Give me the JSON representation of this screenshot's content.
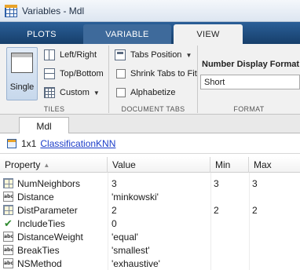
{
  "window": {
    "title": "Variables - Mdl"
  },
  "ribbon_tabs": [
    {
      "label": "PLOTS"
    },
    {
      "label": "VARIABLE"
    },
    {
      "label": "VIEW"
    }
  ],
  "tiles": {
    "single_label": "Single",
    "left_right": "Left/Right",
    "top_bottom": "Top/Bottom",
    "custom": "Custom",
    "section_label": "TILES"
  },
  "document_tabs": {
    "tabs_position": "Tabs Position",
    "shrink_tabs": "Shrink Tabs to Fit",
    "alphabetize": "Alphabetize",
    "section_label": "DOCUMENT TABS"
  },
  "format": {
    "label": "Number Display Format",
    "selected": "Short",
    "section_label": "FORMAT"
  },
  "doc_tab": {
    "label": "Mdl"
  },
  "info": {
    "size": "1x1",
    "class_name": "ClassificationKNN"
  },
  "table": {
    "headers": [
      "Property",
      "Value",
      "Min",
      "Max"
    ],
    "rows": [
      {
        "icon": "grid-icon",
        "property": "NumNeighbors",
        "value": "3",
        "min": "3",
        "max": "3"
      },
      {
        "icon": "text-icon",
        "property": "Distance",
        "value": "'minkowski'",
        "min": "",
        "max": ""
      },
      {
        "icon": "grid-icon",
        "property": "DistParameter",
        "value": "2",
        "min": "2",
        "max": "2"
      },
      {
        "icon": "check-icon",
        "property": "IncludeTies",
        "value": "0",
        "min": "",
        "max": ""
      },
      {
        "icon": "text-icon",
        "property": "DistanceWeight",
        "value": "'equal'",
        "min": "",
        "max": ""
      },
      {
        "icon": "text-icon",
        "property": "BreakTies",
        "value": "'smallest'",
        "min": "",
        "max": ""
      },
      {
        "icon": "text-icon",
        "property": "NSMethod",
        "value": "'exhaustive'",
        "min": "",
        "max": ""
      }
    ]
  }
}
